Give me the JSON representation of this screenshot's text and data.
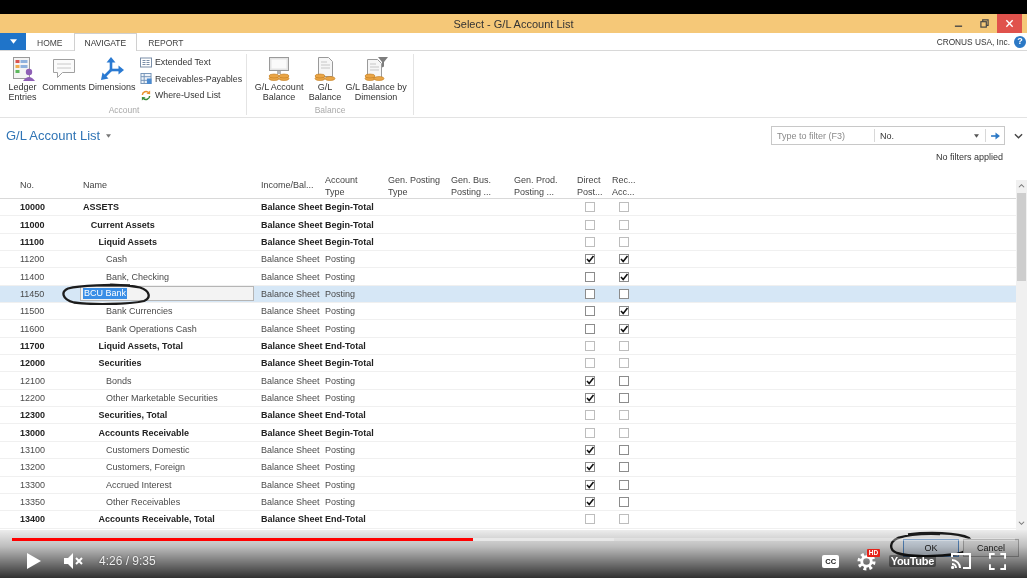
{
  "window": {
    "title": "Select - G/L Account List"
  },
  "ribbon": {
    "tabs": [
      {
        "label": "HOME",
        "selected": false
      },
      {
        "label": "NAVIGATE",
        "selected": true
      },
      {
        "label": "REPORT",
        "selected": false
      }
    ],
    "company": "CRONUS USA, Inc.",
    "help": "?",
    "groups": [
      {
        "label": "Account",
        "buttons": [
          "Ledger Entries",
          "Comments",
          "Dimensions"
        ],
        "links": [
          "Extended Text",
          "Receivables-Payables",
          "Where-Used List"
        ]
      },
      {
        "label": "Balance",
        "buttons": [
          "G/L Account Balance",
          "G/L Balance",
          "G/L Balance by Dimension"
        ]
      }
    ]
  },
  "page": {
    "title": "G/L Account List",
    "filter": {
      "placeholder": "Type to filter (F3)",
      "field": "No."
    },
    "filter_status": "No filters applied"
  },
  "table": {
    "columns": [
      "No.",
      "Name",
      "Income/Bal...",
      "Account Type",
      "Gen. Posting Type",
      "Gen. Bus. Posting ...",
      "Gen. Prod. Posting ...",
      "Direct Post...",
      "Rec... Acc..."
    ],
    "rows": [
      {
        "no": "10000",
        "name": "ASSETS",
        "income_balance": "Balance Sheet",
        "account_type": "Begin-Total",
        "kind": "total",
        "direct_posting": false,
        "reconciliation_account": false,
        "selected": false,
        "children": [
          {
            "no": "11000",
            "name": "Current Assets",
            "income_balance": "Balance Sheet",
            "account_type": "Begin-Total",
            "kind": "total",
            "direct_posting": false,
            "reconciliation_account": false,
            "selected": false,
            "children": [
              {
                "no": "11100",
                "name": "Liquid Assets",
                "income_balance": "Balance Sheet",
                "account_type": "Begin-Total",
                "kind": "total",
                "direct_posting": false,
                "reconciliation_account": false,
                "selected": false,
                "children": [
                  {
                    "no": "11200",
                    "name": "Cash",
                    "income_balance": "Balance Sheet",
                    "account_type": "Posting",
                    "kind": "posting",
                    "direct_posting": true,
                    "reconciliation_account": true,
                    "selected": false
                  },
                  {
                    "no": "11400",
                    "name": "Bank, Checking",
                    "income_balance": "Balance Sheet",
                    "account_type": "Posting",
                    "kind": "posting",
                    "direct_posting": false,
                    "reconciliation_account": true,
                    "selected": false
                  },
                  {
                    "no": "11450",
                    "name": "BCU Bank",
                    "income_balance": "Balance Sheet",
                    "account_type": "Posting",
                    "kind": "posting",
                    "direct_posting": false,
                    "reconciliation_account": false,
                    "selected": true
                  },
                  {
                    "no": "11500",
                    "name": "Bank Currencies",
                    "income_balance": "Balance Sheet",
                    "account_type": "Posting",
                    "kind": "posting",
                    "direct_posting": false,
                    "reconciliation_account": true,
                    "selected": false
                  },
                  {
                    "no": "11600",
                    "name": "Bank Operations Cash",
                    "income_balance": "Balance Sheet",
                    "account_type": "Posting",
                    "kind": "posting",
                    "direct_posting": false,
                    "reconciliation_account": true,
                    "selected": false
                  }
                ]
              },
              {
                "no": "11700",
                "name": "Liquid Assets, Total",
                "income_balance": "Balance Sheet",
                "account_type": "End-Total",
                "kind": "total",
                "direct_posting": false,
                "reconciliation_account": false,
                "selected": false
              },
              {
                "no": "12000",
                "name": "Securities",
                "income_balance": "Balance Sheet",
                "account_type": "Begin-Total",
                "kind": "total",
                "direct_posting": false,
                "reconciliation_account": false,
                "selected": false,
                "children": [
                  {
                    "no": "12100",
                    "name": "Bonds",
                    "income_balance": "Balance Sheet",
                    "account_type": "Posting",
                    "kind": "posting",
                    "direct_posting": true,
                    "reconciliation_account": false,
                    "selected": false
                  },
                  {
                    "no": "12200",
                    "name": "Other Marketable Securities",
                    "income_balance": "Balance Sheet",
                    "account_type": "Posting",
                    "kind": "posting",
                    "direct_posting": true,
                    "reconciliation_account": false,
                    "selected": false
                  }
                ]
              },
              {
                "no": "12300",
                "name": "Securities, Total",
                "income_balance": "Balance Sheet",
                "account_type": "End-Total",
                "kind": "total",
                "direct_posting": false,
                "reconciliation_account": false,
                "selected": false
              },
              {
                "no": "13000",
                "name": "Accounts Receivable",
                "income_balance": "Balance Sheet",
                "account_type": "Begin-Total",
                "kind": "total",
                "direct_posting": false,
                "reconciliation_account": false,
                "selected": false,
                "children": [
                  {
                    "no": "13100",
                    "name": "Customers Domestic",
                    "income_balance": "Balance Sheet",
                    "account_type": "Posting",
                    "kind": "posting",
                    "direct_posting": true,
                    "reconciliation_account": false,
                    "selected": false
                  },
                  {
                    "no": "13200",
                    "name": "Customers, Foreign",
                    "income_balance": "Balance Sheet",
                    "account_type": "Posting",
                    "kind": "posting",
                    "direct_posting": true,
                    "reconciliation_account": false,
                    "selected": false
                  },
                  {
                    "no": "13300",
                    "name": "Accrued Interest",
                    "income_balance": "Balance Sheet",
                    "account_type": "Posting",
                    "kind": "posting",
                    "direct_posting": true,
                    "reconciliation_account": false,
                    "selected": false
                  },
                  {
                    "no": "13350",
                    "name": "Other Receivables",
                    "income_balance": "Balance Sheet",
                    "account_type": "Posting",
                    "kind": "posting",
                    "direct_posting": true,
                    "reconciliation_account": false,
                    "selected": false
                  }
                ]
              },
              {
                "no": "13400",
                "name": "Accounts Receivable, Total",
                "income_balance": "Balance Sheet",
                "account_type": "End-Total",
                "kind": "total",
                "direct_posting": false,
                "reconciliation_account": false,
                "selected": false
              }
            ]
          }
        ]
      }
    ]
  },
  "dialog_buttons": [
    "OK",
    "Cancel"
  ],
  "video_player": {
    "progress_bar": {
      "level": 0.46
    },
    "buffer_bar": {
      "level": 0.6
    },
    "playing": false,
    "muted": true,
    "time": "4:26 / 9:35",
    "captions": "CC",
    "quality_badge": "HD",
    "logo": "YouTube"
  }
}
